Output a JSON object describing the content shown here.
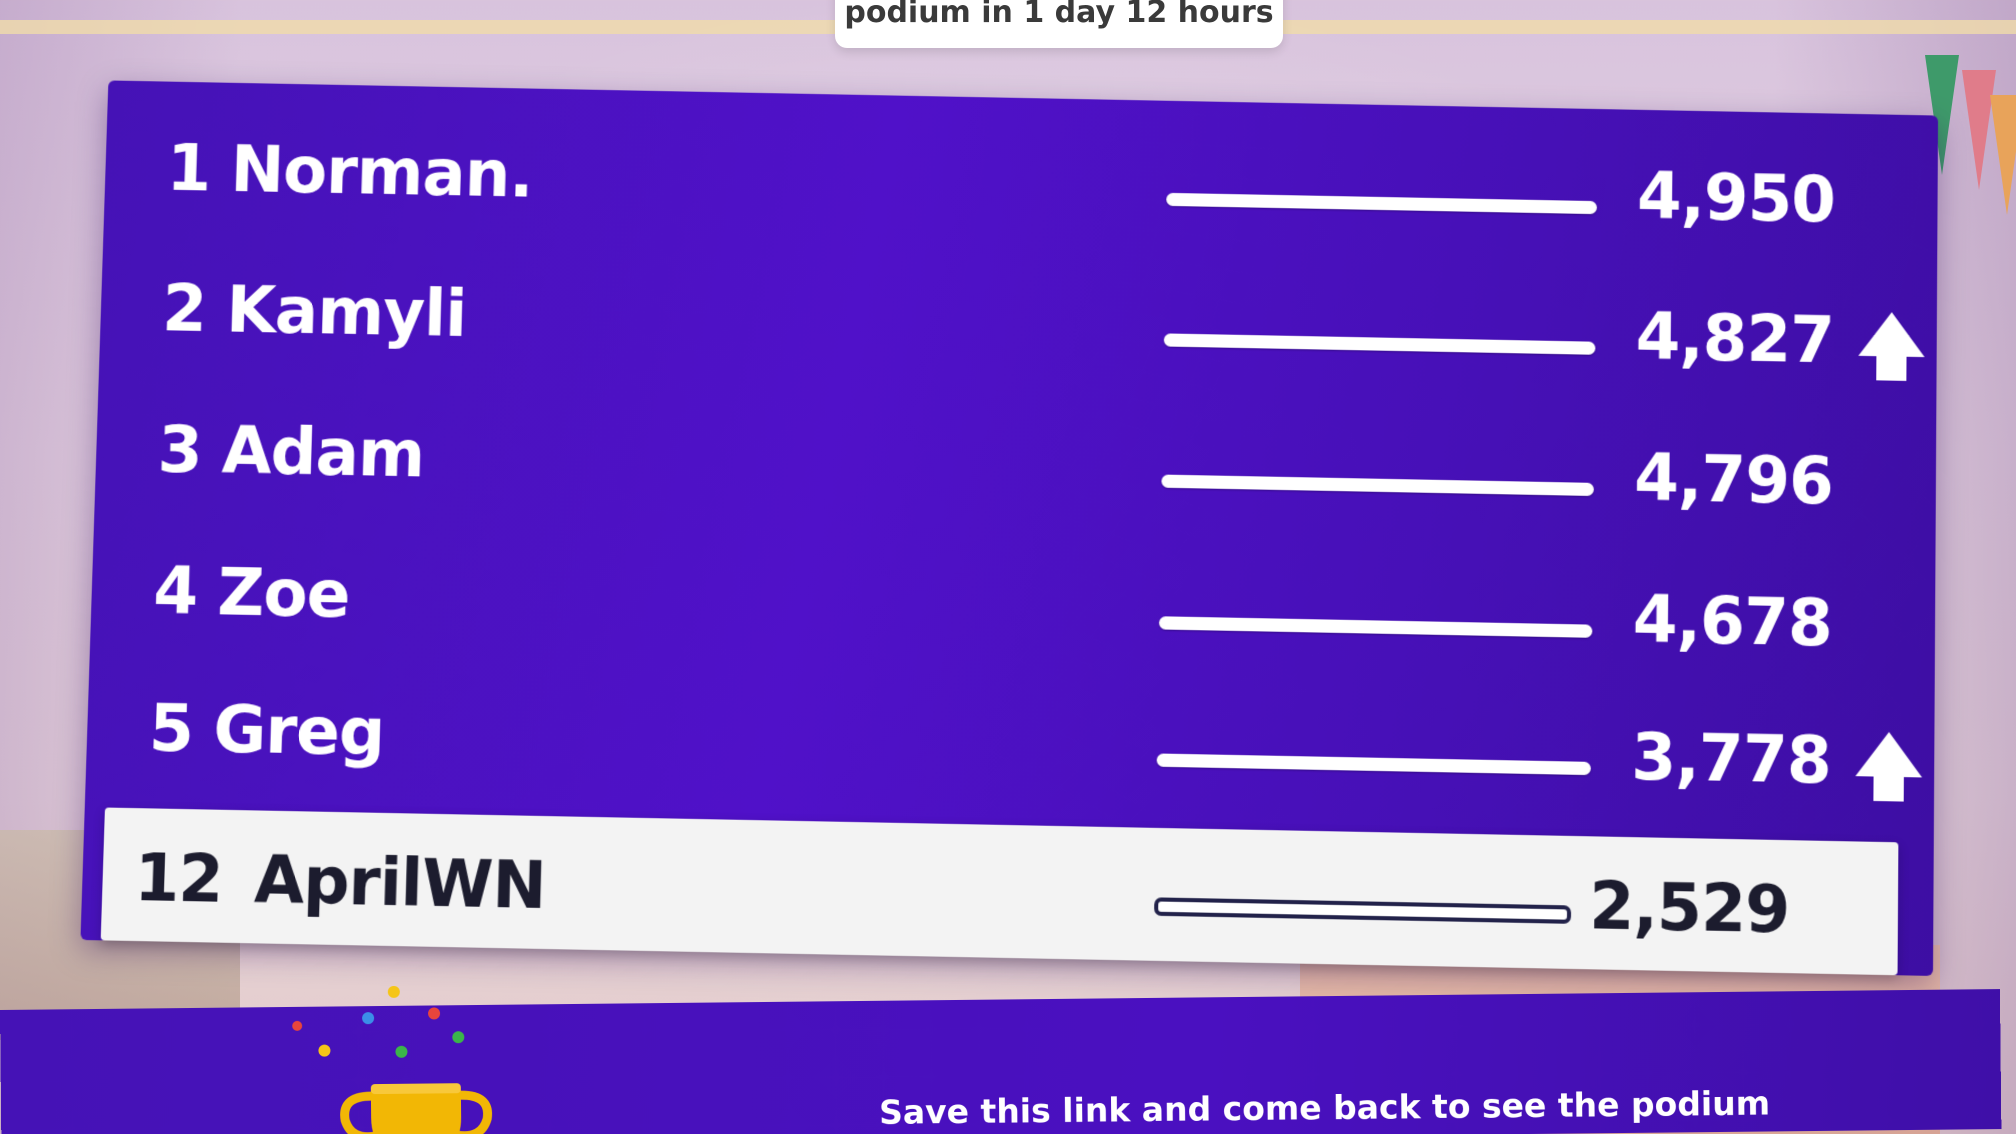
{
  "timer": {
    "text": "podium in 1 day 12 hours"
  },
  "leaderboard": {
    "rows": [
      {
        "rank": "1",
        "name": "Norman.",
        "score": "4,950",
        "trend": null
      },
      {
        "rank": "2",
        "name": "Kamyli",
        "score": "4,827",
        "trend": "up-arrow-icon"
      },
      {
        "rank": "3",
        "name": "Adam",
        "score": "4,796",
        "trend": null
      },
      {
        "rank": "4",
        "name": "Zoe",
        "score": "4,678",
        "trend": null
      },
      {
        "rank": "5",
        "name": "Greg",
        "score": "3,778",
        "trend": "up-arrow-icon"
      }
    ],
    "self": {
      "rank": "12",
      "name": "AprilWN",
      "score": "2,529"
    }
  },
  "footer": {
    "message": "Save this link and come back to see the podium",
    "icon": "trophy-icon"
  },
  "colors": {
    "board": "#4a10c0",
    "self_row": "#f3f3f3",
    "text_light": "#ffffff",
    "text_dark": "#1c1c2e"
  }
}
